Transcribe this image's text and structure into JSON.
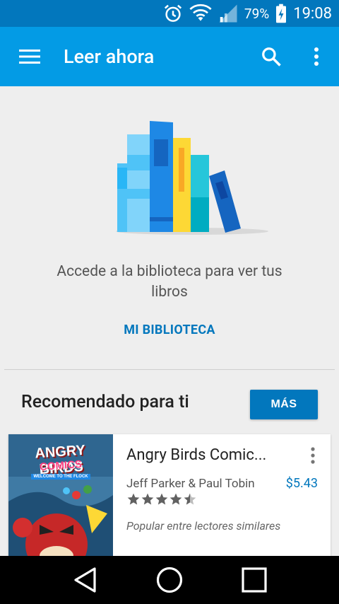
{
  "status": {
    "battery": "79%",
    "time": "19:08"
  },
  "toolbar": {
    "title": "Leer ahora"
  },
  "empty_state": {
    "message": "Accede a la biblioteca para ver tus libros",
    "link": "MI BIBLIOTECA"
  },
  "recommendations": {
    "title": "Recomendado para ti",
    "more_button": "MÁS",
    "book": {
      "title": "Angry Birds Comic...",
      "author": "Jeff Parker & Paul Tobin",
      "price": "$5.43",
      "rating": 4.5,
      "note": "Popular entre lectores similares",
      "cover_title": "ANGRY BIRDS",
      "cover_subtitle": "COMICS",
      "cover_banner": "WELCOME TO THE FLOCK"
    }
  },
  "colors": {
    "status_bar": "#0277bd",
    "toolbar": "#039be5",
    "accent": "#0277bd",
    "background": "#eeeeee"
  }
}
